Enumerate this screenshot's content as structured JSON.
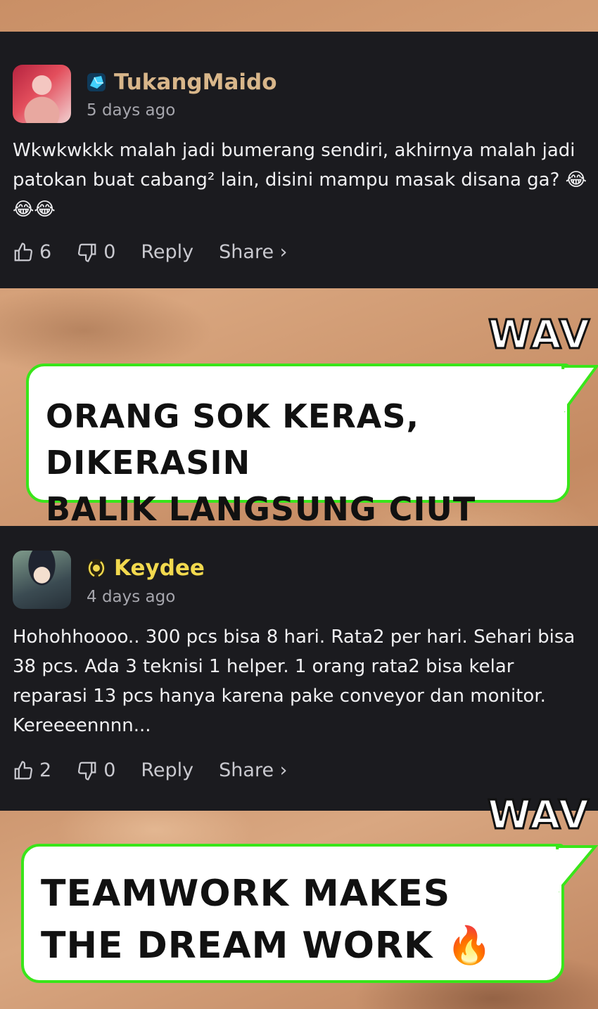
{
  "header": {
    "fragment_text": ""
  },
  "comments": [
    {
      "username": "TukangMaido",
      "time": "5 days ago",
      "text": "Wkwkwkkk malah jadi bumerang sendiri, akhirnya malah jadi patokan buat cabang² lain, disini mampu masak disana ga? 😂😂😂",
      "likes": "6",
      "dislikes": "0",
      "reply_label": "Reply",
      "share_label": "Share ›",
      "badge_icon": "crystal-badge-icon",
      "name_color": "#d8b68a"
    },
    {
      "username": "Keydee",
      "time": "4 days ago",
      "text": "Hohohhoooo.. 300 pcs bisa 8 hari. Rata2 per hari. Sehari bisa 38 pcs. Ada 3 teknisi 1 helper. 1 orang rata2 bisa kelar reparasi 13 pcs hanya karena pake conveyor dan monitor. Kereeeennnn...",
      "likes": "2",
      "dislikes": "0",
      "reply_label": "Reply",
      "share_label": "Share ›",
      "badge_icon": "wreath-badge-icon",
      "name_color": "#f2d94e"
    }
  ],
  "bubbles": [
    {
      "speaker": "WAV",
      "text_line1": "ORANG SOK KERAS, DIKERASIN",
      "text_line2": "BALIK LANGSUNG CIUT"
    },
    {
      "speaker": "WAV",
      "text_line1": "TEAMWORK MAKES",
      "text_line2": "THE DREAM WORK 🔥"
    }
  ],
  "colors": {
    "card_bg": "#1b1b1f",
    "bubble_border": "#39e51a",
    "meta_text": "#a6a6ad"
  }
}
